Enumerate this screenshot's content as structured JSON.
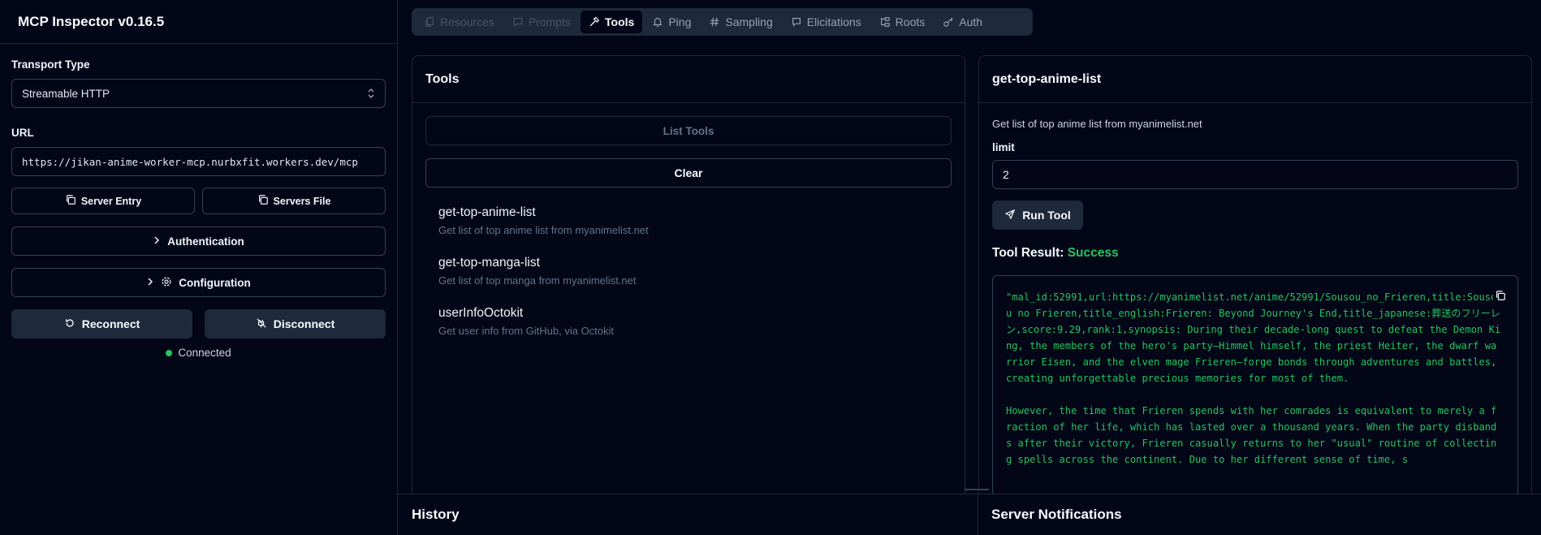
{
  "app": {
    "title": "MCP Inspector v0.16.5"
  },
  "sidebar": {
    "transport_label": "Transport Type",
    "transport_value": "Streamable HTTP",
    "url_label": "URL",
    "url_value": "https://jikan-anime-worker-mcp.nurbxfit.workers.dev/mcp",
    "server_entry_label": "Server Entry",
    "servers_file_label": "Servers File",
    "authentication_label": "Authentication",
    "configuration_label": "Configuration",
    "reconnect_label": "Reconnect",
    "disconnect_label": "Disconnect",
    "status_text": "Connected",
    "status_color": "#22c55e"
  },
  "tabs": [
    {
      "label": "Resources",
      "icon": "files-icon",
      "state": "disabled"
    },
    {
      "label": "Prompts",
      "icon": "message-square-icon",
      "state": "disabled"
    },
    {
      "label": "Tools",
      "icon": "hammer-icon",
      "state": "active"
    },
    {
      "label": "Ping",
      "icon": "bell-icon",
      "state": "normal"
    },
    {
      "label": "Sampling",
      "icon": "hash-icon",
      "state": "normal"
    },
    {
      "label": "Elicitations",
      "icon": "message-circle-icon",
      "state": "normal"
    },
    {
      "label": "Roots",
      "icon": "folder-tree-icon",
      "state": "normal"
    },
    {
      "label": "Auth",
      "icon": "key-icon",
      "state": "normal"
    }
  ],
  "tools_panel": {
    "title": "Tools",
    "list_tools_label": "List Tools",
    "clear_label": "Clear",
    "items": [
      {
        "name": "get-top-anime-list",
        "description": "Get list of top anime list from myanimelist.net"
      },
      {
        "name": "get-top-manga-list",
        "description": "Get list of top manga from myanimelist.net"
      },
      {
        "name": "userInfoOctokit",
        "description": "Get user info from GitHub, via Octokit"
      }
    ]
  },
  "detail_panel": {
    "title": "get-top-anime-list",
    "description": "Get list of top anime list from myanimelist.net",
    "param_label": "limit",
    "param_value": "2",
    "run_label": "Run Tool",
    "result_label": "Tool Result:",
    "result_status": "Success",
    "result_text": "\"mal_id:52991,url:https://myanimelist.net/anime/52991/Sousou_no_Frieren,title:Sousou no Frieren,title_english:Frieren: Beyond Journey's End,title_japanese:葬送のフリーレン,score:9.29,rank:1,synopsis: During their decade-long quest to defeat the Demon King, the members of the hero's party—Himmel himself, the priest Heiter, the dwarf warrior Eisen, and the elven mage Frieren—forge bonds through adventures and battles, creating unforgettable precious memories for most of them.\n\nHowever, the time that Frieren spends with her comrades is equivalent to merely a fraction of her life, which has lasted over a thousand years. When the party disbands after their victory, Frieren casually returns to her \"usual\" routine of collecting spells across the continent. Due to her different sense of time, s"
  },
  "bottom": {
    "history_label": "History",
    "notifications_label": "Server Notifications"
  }
}
